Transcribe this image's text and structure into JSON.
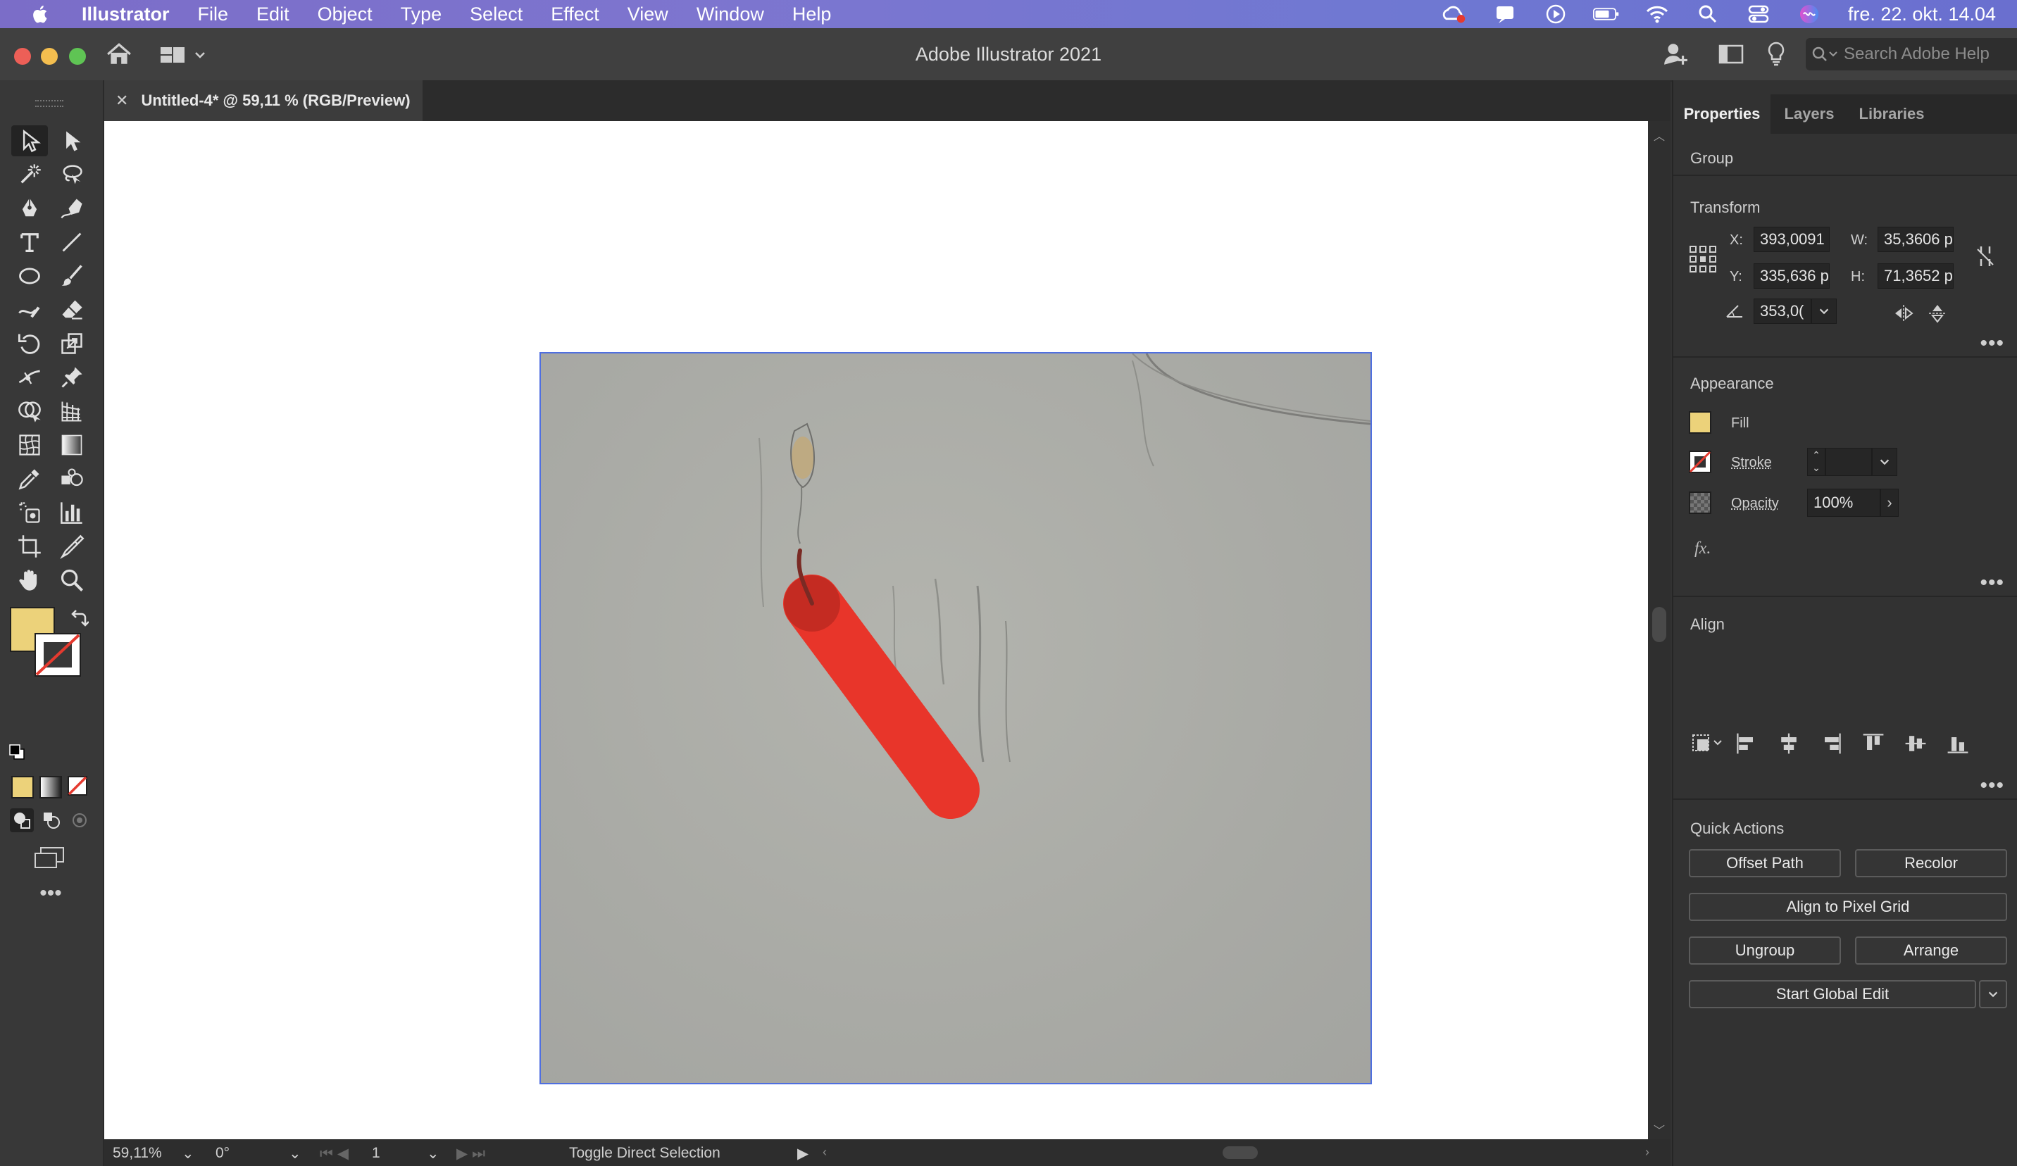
{
  "menubar": {
    "app_name": "Illustrator",
    "items": [
      "File",
      "Edit",
      "Object",
      "Type",
      "Select",
      "Effect",
      "View",
      "Window",
      "Help"
    ],
    "clock": "fre. 22. okt. 14.04"
  },
  "titlebar": {
    "title": "Adobe Illustrator 2021",
    "search_placeholder": "Search Adobe Help"
  },
  "document": {
    "tab_label": "Untitled-4* @ 59,11 % (RGB/Preview)"
  },
  "statusbar": {
    "zoom": "59,11%",
    "rotation": "0°",
    "artboard_number": "1",
    "status_text": "Toggle Direct Selection"
  },
  "panel": {
    "tabs": [
      "Properties",
      "Layers",
      "Libraries"
    ],
    "selection_type": "Group",
    "transform": {
      "title": "Transform",
      "x_label": "X:",
      "x_value": "393,0091",
      "y_label": "Y:",
      "y_value": "335,636 p",
      "w_label": "W:",
      "w_value": "35,3606 p",
      "h_label": "H:",
      "h_value": "71,3652 p",
      "angle_value": "353,0("
    },
    "appearance": {
      "title": "Appearance",
      "fill_label": "Fill",
      "stroke_label": "Stroke",
      "opacity_label": "Opacity",
      "opacity_value": "100%",
      "fx_label": "fx."
    },
    "align": {
      "title": "Align"
    },
    "quick_actions": {
      "title": "Quick Actions",
      "offset_path": "Offset Path",
      "recolor": "Recolor",
      "align_pixel_grid": "Align to Pixel Grid",
      "ungroup": "Ungroup",
      "arrange": "Arrange",
      "start_global_edit": "Start Global Edit"
    }
  },
  "colors": {
    "fill_swatch": "#ecd27a",
    "dynamite_red": "#e8352a",
    "selection_blue": "#4f6fe0"
  }
}
